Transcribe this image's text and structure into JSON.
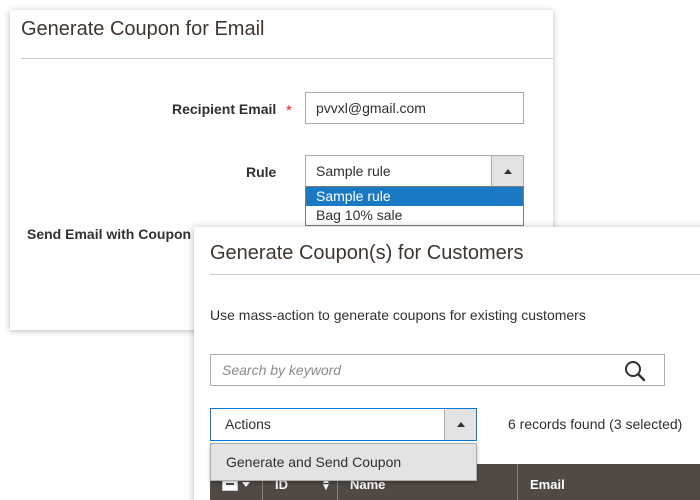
{
  "coupon_email_panel": {
    "title": "Generate Coupon for Email",
    "recipient_label": "Recipient Email",
    "required_mark": "*",
    "recipient_value": "pvvxl@gmail.com",
    "rule_label": "Rule",
    "rule_selected": "Sample rule",
    "rule_options": [
      "Sample rule",
      "Bag 10% sale"
    ],
    "send_email_label": "Send Email with Coupon"
  },
  "customers_panel": {
    "title": "Generate Coupon(s) for Customers",
    "description": "Use mass-action to generate coupons for existing customers",
    "search_placeholder": "Search by keyword",
    "actions_label": "Actions",
    "records_text": "6 records found (3 selected)",
    "action_menu_items": [
      "Generate and Send Coupon"
    ],
    "grid_columns": [
      "ID",
      "Name",
      "Email"
    ]
  },
  "colors": {
    "accent_blue": "#1979c3",
    "focus_border": "#007bdb",
    "grid_header_bg": "#514943",
    "required_red": "#e22626"
  }
}
